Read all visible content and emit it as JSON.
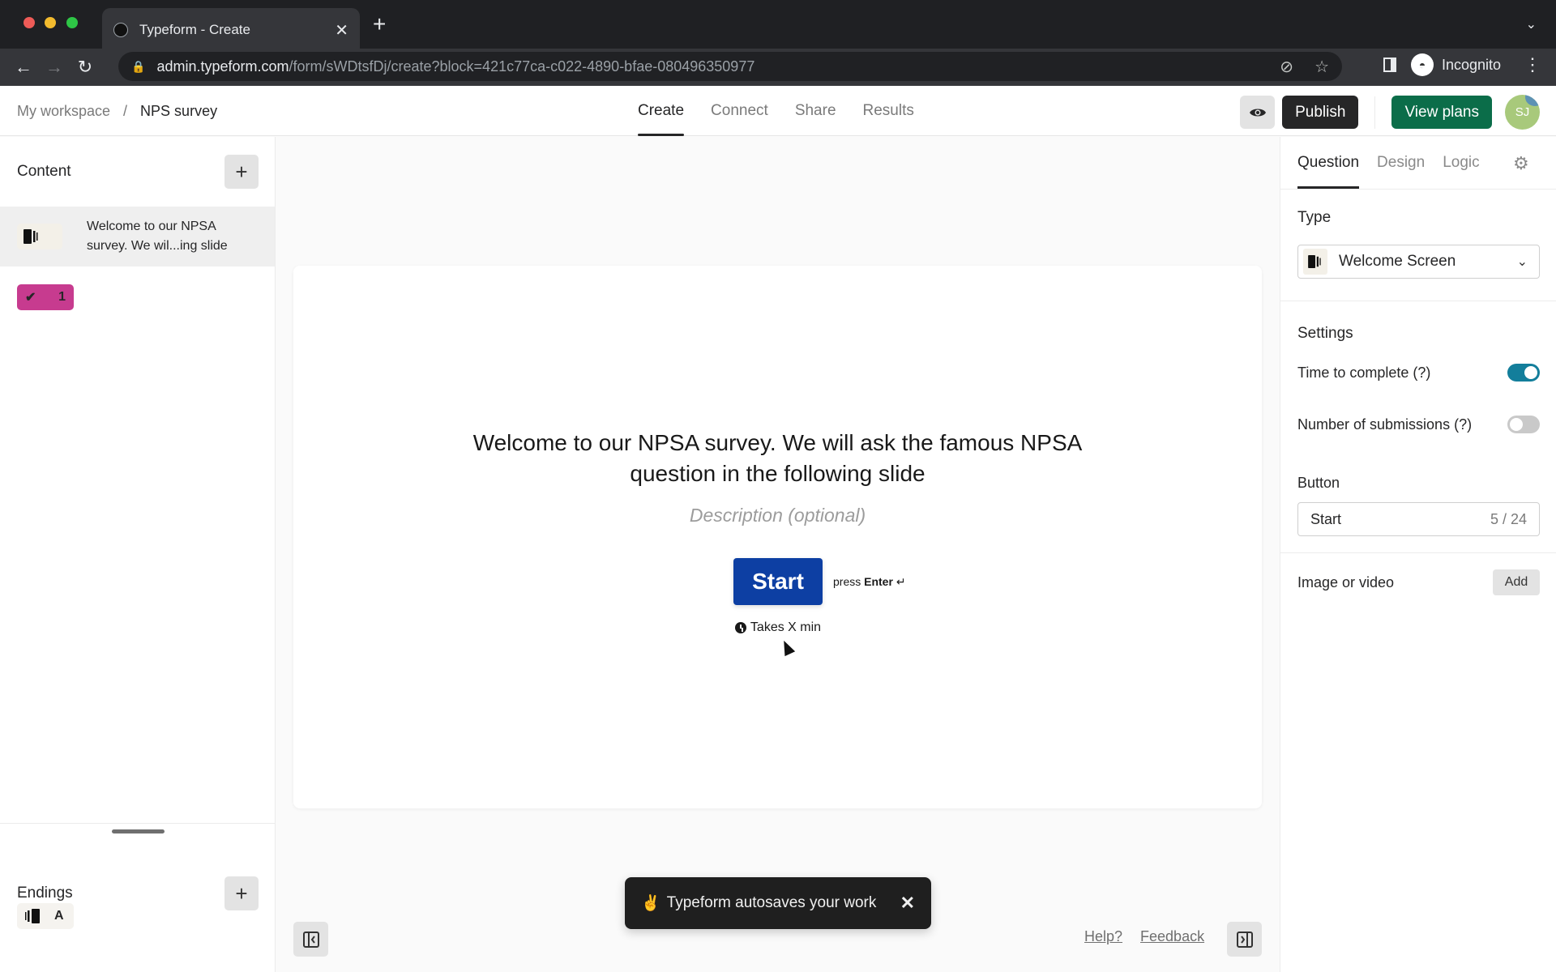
{
  "browser": {
    "tab_title": "Typeform - Create",
    "url_host": "admin.typeform.com",
    "url_path": "/form/sWDtsfDj/create?block=421c77ca-c022-4890-bfae-080496350977",
    "profile_label": "Incognito"
  },
  "header": {
    "breadcrumb": {
      "workspace": "My workspace",
      "separator": "/",
      "current": "NPS survey"
    },
    "tabs": [
      {
        "label": "Create",
        "active": true
      },
      {
        "label": "Connect",
        "active": false
      },
      {
        "label": "Share",
        "active": false
      },
      {
        "label": "Results",
        "active": false
      }
    ],
    "publish_label": "Publish",
    "view_plans_label": "View plans",
    "avatar_initials": "SJ"
  },
  "left_panel": {
    "content_title": "Content",
    "items": [
      {
        "type": "welcome-screen",
        "text": "Welcome to our NPSA survey. We wil...ing slide",
        "selected": true
      },
      {
        "type": "question",
        "number": "1",
        "color": "#c73b8f"
      }
    ],
    "endings_title": "Endings",
    "endings": [
      {
        "label": "A"
      }
    ]
  },
  "canvas": {
    "title": "Welcome to our NPSA survey. We will ask the famous NPSA question in the following slide",
    "description_placeholder": "Description (optional)",
    "start_label": "Start",
    "press_prefix": "press",
    "press_key": "Enter",
    "press_glyph": "↵",
    "takes_label": "Takes X min",
    "button_color": "#0d3fa3"
  },
  "toast": {
    "emoji": "✌",
    "message": "Typeform autosaves your work"
  },
  "footer": {
    "help": "Help?",
    "feedback": "Feedback"
  },
  "right_panel": {
    "tabs": [
      {
        "label": "Question",
        "active": true
      },
      {
        "label": "Design",
        "active": false
      },
      {
        "label": "Logic",
        "active": false
      }
    ],
    "type_label": "Type",
    "type_value": "Welcome Screen",
    "settings_label": "Settings",
    "time_to_complete": {
      "label": "Time to complete (?)",
      "on": true
    },
    "number_of_submissions": {
      "label": "Number of submissions (?)",
      "on": false
    },
    "button_label": "Button",
    "button_value": "Start",
    "button_count": "5 / 24",
    "image_label": "Image or video",
    "add_label": "Add"
  }
}
